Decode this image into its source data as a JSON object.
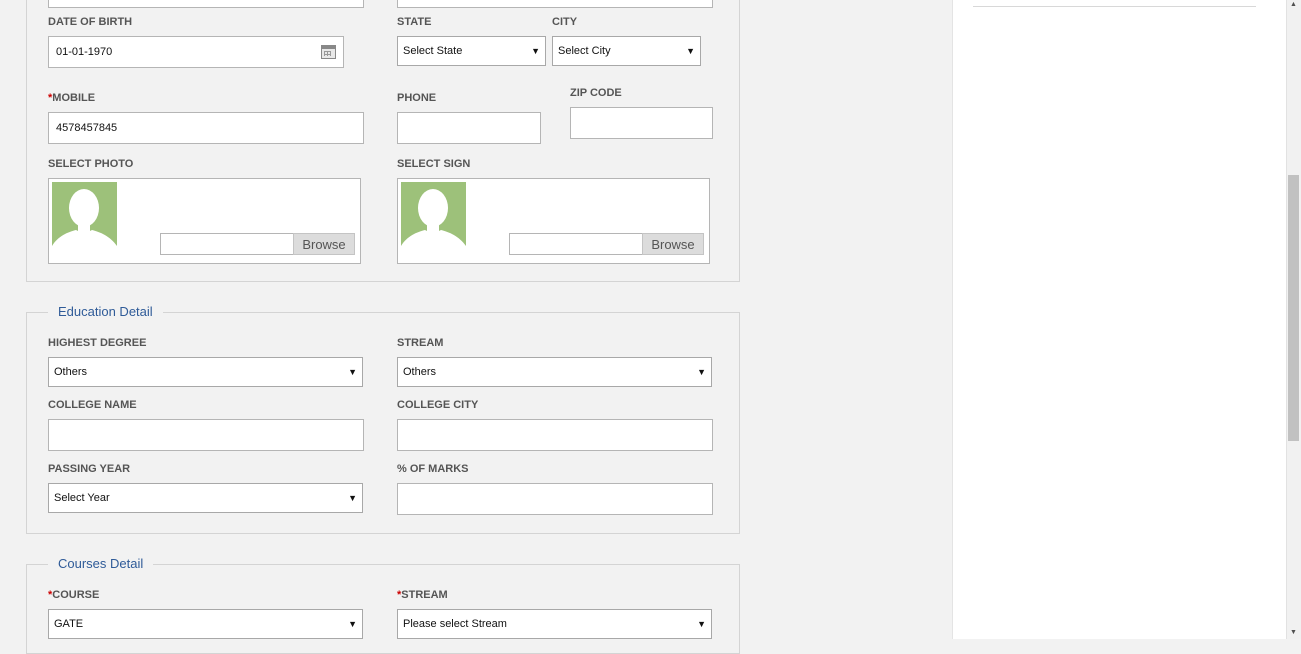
{
  "personal": {
    "dob": {
      "label": "DATE OF BIRTH",
      "value": "01-01-1970",
      "icon": "calendar-icon"
    },
    "state": {
      "label": "STATE",
      "selected": "Select State"
    },
    "city": {
      "label": "CITY",
      "selected": "Select City"
    },
    "mobile": {
      "required_mark": "*",
      "label": "MOBILE",
      "value": "4578457845"
    },
    "phone": {
      "label": "PHONE",
      "value": ""
    },
    "zip": {
      "label": "ZIP CODE",
      "value": ""
    },
    "photo": {
      "label": "SELECT PHOTO",
      "browse": "Browse"
    },
    "sign": {
      "label": "SELECT SIGN",
      "browse": "Browse"
    }
  },
  "education": {
    "legend": "Education Detail",
    "highest_degree": {
      "label": "HIGHEST DEGREE",
      "selected": "Others"
    },
    "stream": {
      "label": "STREAM",
      "selected": "Others"
    },
    "college_name": {
      "label": "COLLEGE NAME",
      "value": ""
    },
    "college_city": {
      "label": "COLLEGE CITY",
      "value": ""
    },
    "passing_year": {
      "label": "PASSING YEAR",
      "selected": "Select Year"
    },
    "marks": {
      "label": "% OF MARKS",
      "value": ""
    }
  },
  "courses": {
    "legend": "Courses Detail",
    "course": {
      "required_mark": "*",
      "label": "COURSE",
      "selected": "GATE"
    },
    "stream": {
      "required_mark": "*",
      "label": "STREAM",
      "selected": "Please select Stream"
    }
  },
  "scroll": {
    "up_icon": "▲",
    "down_icon": "▼"
  },
  "colors": {
    "legend": "#2f5b98",
    "required": "#cc0000",
    "avatar_bg": "#9dc17a"
  }
}
